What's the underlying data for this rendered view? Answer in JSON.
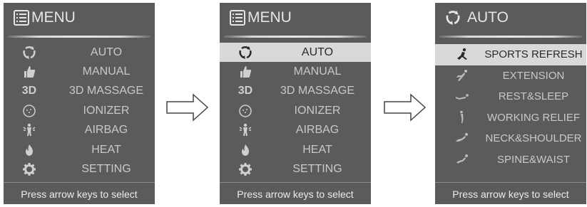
{
  "menu_panel": {
    "title": "MENU",
    "items": [
      {
        "label": "AUTO",
        "icon": "auto-cycle-icon"
      },
      {
        "label": "MANUAL",
        "icon": "thumbs-up-icon"
      },
      {
        "label": "3D MASSAGE",
        "icon_text": "3D"
      },
      {
        "label": "IONIZER",
        "icon": "ionizer-icon"
      },
      {
        "label": "AIRBAG",
        "icon": "airbag-person-icon"
      },
      {
        "label": "HEAT",
        "icon": "flame-icon"
      },
      {
        "label": "SETTING",
        "icon": "gear-icon"
      }
    ],
    "footer": "Press arrow keys to select"
  },
  "menu_selected_panel": {
    "title": "MENU",
    "selected_index": 0,
    "items": [
      {
        "label": "AUTO"
      },
      {
        "label": "MANUAL"
      },
      {
        "label": "3D MASSAGE",
        "icon_text": "3D"
      },
      {
        "label": "IONIZER"
      },
      {
        "label": "AIRBAG"
      },
      {
        "label": "HEAT"
      },
      {
        "label": "SETTING"
      }
    ],
    "footer": "Press arrow keys to select"
  },
  "auto_panel": {
    "title": "AUTO",
    "selected_index": 0,
    "items": [
      {
        "label": "SPORTS REFRESH",
        "icon": "sports-refresh-icon"
      },
      {
        "label": "EXTENSION",
        "icon": "extension-icon"
      },
      {
        "label": "REST&SLEEP",
        "icon": "rest-sleep-icon"
      },
      {
        "label": "WORKING RELIEF",
        "icon": "working-relief-icon"
      },
      {
        "label": "NECK&SHOULDER",
        "icon": "neck-shoulder-icon"
      },
      {
        "label": "SPINE&WAIST",
        "icon": "spine-waist-icon"
      }
    ],
    "footer": "Press arrow keys to select"
  },
  "colors": {
    "panel_bg": "#5b5b5b",
    "text": "#c9c9c9",
    "highlight_bg": "#d9d9d9",
    "highlight_text": "#2b2b2b"
  }
}
